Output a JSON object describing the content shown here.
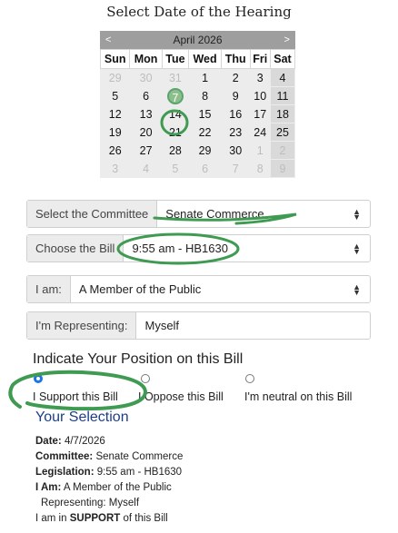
{
  "page": {
    "title": "Select Date of the Hearing"
  },
  "calendar": {
    "prev": "<",
    "next": ">",
    "month": "April 2026",
    "weekdays": [
      "Sun",
      "Mon",
      "Tue",
      "Wed",
      "Thu",
      "Fri",
      "Sat"
    ],
    "weeks": [
      [
        "29",
        "30",
        "31",
        "1",
        "2",
        "3",
        "4"
      ],
      [
        "5",
        "6",
        "7",
        "8",
        "9",
        "10",
        "11"
      ],
      [
        "12",
        "13",
        "14",
        "15",
        "16",
        "17",
        "18"
      ],
      [
        "19",
        "20",
        "21",
        "22",
        "23",
        "24",
        "25"
      ],
      [
        "26",
        "27",
        "28",
        "29",
        "30",
        "1",
        "2"
      ],
      [
        "3",
        "4",
        "5",
        "6",
        "7",
        "8",
        "9"
      ]
    ],
    "selected": "7"
  },
  "form": {
    "committee": {
      "label": "Select the Committee",
      "value": "Senate Commerce"
    },
    "bill": {
      "label": "Choose the Bill",
      "value": "9:55 am - HB1630"
    },
    "iam": {
      "label": "I am:",
      "value": "A Member of the Public"
    },
    "representing": {
      "label": "I'm Representing:",
      "value": "Myself"
    }
  },
  "position": {
    "heading": "Indicate Your Position on this Bill",
    "options": [
      "I Support this Bill",
      "I Oppose this Bill",
      "I'm neutral on this Bill"
    ],
    "selected_index": 0
  },
  "selection": {
    "heading": "Your Selection",
    "date_label": "Date:",
    "date": "4/7/2026",
    "committee_label": "Committee:",
    "committee": "Senate Commerce",
    "legislation_label": "Legislation:",
    "legislation": "9:55 am - HB1630",
    "iam_label": "I Am:",
    "iam": "A Member of the Public",
    "representing": "Representing: Myself",
    "support_prefix": "I am in",
    "support_word": "SUPPORT",
    "support_suffix": "of this Bill"
  },
  "colors": {
    "highlight_green": "#3f9a52",
    "selection_blue": "#1d3f8a",
    "radio_blue": "#1a73e8"
  }
}
